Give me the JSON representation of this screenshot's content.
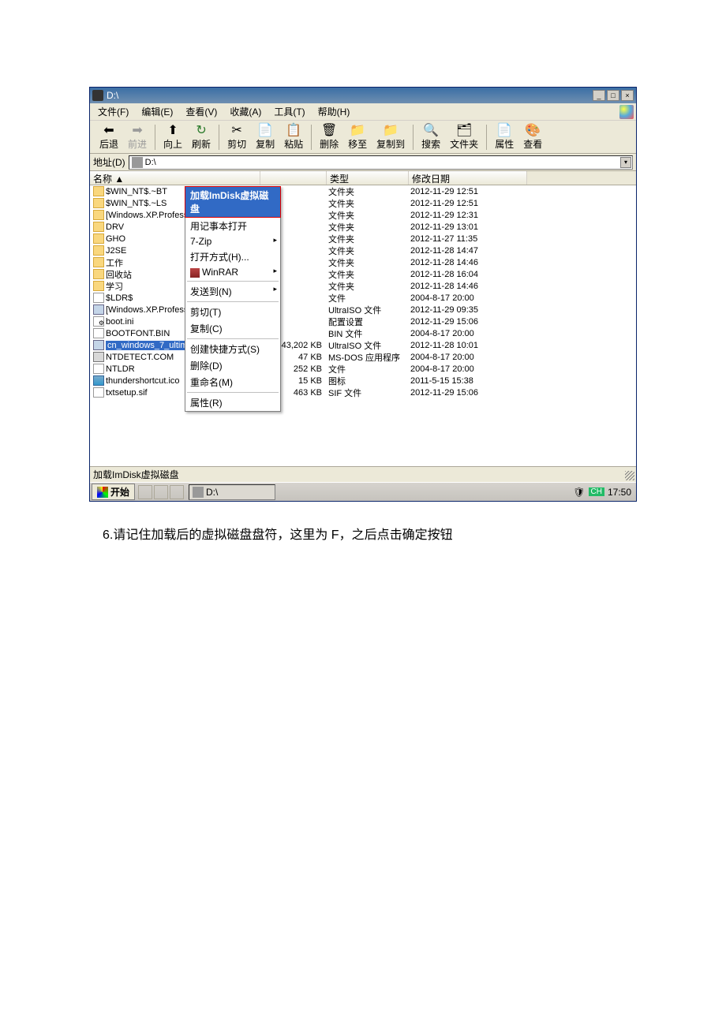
{
  "window": {
    "title": "D:\\"
  },
  "menubar": {
    "file": "文件(F)",
    "edit": "编辑(E)",
    "view": "查看(V)",
    "fav": "收藏(A)",
    "tools": "工具(T)",
    "help": "帮助(H)"
  },
  "toolbar": {
    "back": "后退",
    "forward": "前进",
    "up": "向上",
    "refresh": "刷新",
    "cut": "剪切",
    "copy": "复制",
    "paste": "粘贴",
    "delete": "删除",
    "moveto": "移至",
    "copyto": "复制到",
    "search": "搜索",
    "folders": "文件夹",
    "props": "属性",
    "views": "查看"
  },
  "address": {
    "label": "地址(D)",
    "value": "D:\\"
  },
  "columns": {
    "name": "名称 ▲",
    "size": "",
    "type": "类型",
    "date": "修改日期"
  },
  "ctx": {
    "highlight": "加载ImDisk虚拟磁盘",
    "notepad": "用记事本打开",
    "sevenzip": "7-Zip",
    "openwith": "打开方式(H)...",
    "winrar": "WinRAR",
    "sendto": "发送到(N)",
    "cut": "剪切(T)",
    "copy": "复制(C)",
    "shortcut": "创建快捷方式(S)",
    "delete": "删除(D)",
    "rename": "重命名(M)",
    "props": "属性(R)"
  },
  "rows": [
    {
      "icon": "fold",
      "name": "$WIN_NT$.~BT",
      "size": "",
      "type": "文件夹",
      "date": "2012-11-29 12:51"
    },
    {
      "icon": "fold",
      "name": "$WIN_NT$.~LS",
      "size": "",
      "type": "文件夹",
      "date": "2012-11-29 12:51"
    },
    {
      "icon": "fold",
      "name": "[Windows.XP.Profess",
      "size": "",
      "type": "文件夹",
      "date": "2012-11-29 12:31"
    },
    {
      "icon": "fold",
      "name": "DRV",
      "size": "",
      "type": "文件夹",
      "date": "2012-11-29 13:01"
    },
    {
      "icon": "fold",
      "name": "GHO",
      "size": "",
      "type": "文件夹",
      "date": "2012-11-27 11:35"
    },
    {
      "icon": "fold",
      "name": "J2SE",
      "size": "",
      "type": "文件夹",
      "date": "2012-11-28 14:47"
    },
    {
      "icon": "fold",
      "name": "工作",
      "size": "",
      "type": "文件夹",
      "date": "2012-11-28 14:46"
    },
    {
      "icon": "fold",
      "name": "回收站",
      "size": "",
      "type": "文件夹",
      "date": "2012-11-28 16:04"
    },
    {
      "icon": "fold",
      "name": "学习",
      "size": "",
      "type": "文件夹",
      "date": "2012-11-28 14:46"
    },
    {
      "icon": "file",
      "name": "$LDR$",
      "size": "",
      "type": "文件",
      "date": "2004-8-17 20:00"
    },
    {
      "icon": "iso",
      "name": "[Windows.XP.Profess",
      "size": "",
      "type": "UltraISO 文件",
      "date": "2012-11-29 09:35"
    },
    {
      "icon": "conf",
      "name": "boot.ini",
      "size": "",
      "type": "配置设置",
      "date": "2012-11-29 15:06"
    },
    {
      "icon": "file",
      "name": "BOOTFONT.BIN",
      "size": "",
      "type": "BIN 文件",
      "date": "2004-8-17 20:00"
    },
    {
      "icon": "iso",
      "name": "cn_windows_7_ultimate_x86_...",
      "size": "2,543,202 KB",
      "type": "UltraISO 文件",
      "date": "2012-11-28 10:01",
      "sel": true
    },
    {
      "icon": "app",
      "name": "NTDETECT.COM",
      "size": "47 KB",
      "type": "MS-DOS 应用程序",
      "date": "2004-8-17 20:00"
    },
    {
      "icon": "file",
      "name": "NTLDR",
      "size": "252 KB",
      "type": "文件",
      "date": "2004-8-17 20:00"
    },
    {
      "icon": "ico",
      "name": "thundershortcut.ico",
      "size": "15 KB",
      "type": "图标",
      "date": "2011-5-15 15:38"
    },
    {
      "icon": "file",
      "name": "txtsetup.sif",
      "size": "463 KB",
      "type": "SIF 文件",
      "date": "2012-11-29 15:06"
    }
  ],
  "status": "加载ImDisk虚拟磁盘",
  "taskbar": {
    "start": "开始",
    "task": "D:\\",
    "lang": "CH",
    "clock": "17:50"
  },
  "caption": "6.请记住加载后的虚拟磁盘盘符，这里为 F，之后点击确定按钮"
}
